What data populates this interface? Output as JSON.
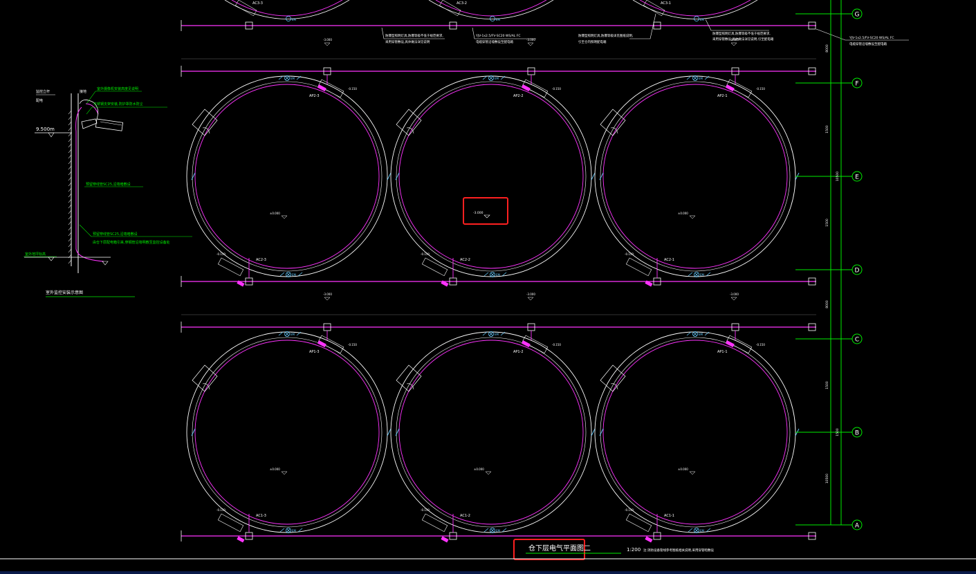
{
  "colors": {
    "background": "#000000",
    "wall": "#ffffff",
    "cable": "#ff33ff",
    "grid_line": "#00ee00",
    "device": "#66ccff",
    "highlight_box": "#ff2020"
  },
  "drawing": {
    "title": "仓下层电气平面图二",
    "scale": "1:200",
    "note": "注:消防设备管线参考图纸相关说明,采用穿管暗敷设",
    "highlight_elevation": "-3.000"
  },
  "grid_axes": [
    "G",
    "F",
    "E",
    "D",
    "C",
    "B",
    "A"
  ],
  "dims": [
    "8000",
    "1500",
    "10500",
    "1500",
    "8000",
    "1500",
    "10500",
    "1500"
  ],
  "silos": {
    "upper_row": [
      "AP2-3",
      "AP2-2",
      "AP2-1"
    ],
    "upper_row_bottom": [
      "AC2-3",
      "AC2-2",
      "AC2-1"
    ],
    "lower_row": [
      "AP1-3",
      "AP1-2",
      "AP1-1"
    ],
    "lower_row_bottom": [
      "AC1-3",
      "AC1-2",
      "AC1-1"
    ],
    "top_cut": [
      "AC3-3",
      "AC3-2",
      "AC3-1"
    ]
  },
  "labels": {
    "em": "EM",
    "center_elev": "±0.000",
    "side_elev": "-0.150",
    "row_elev": "-3.000"
  },
  "top_notes": {
    "n1_line1": "防爆型照明灯具,防爆等级不低于规范要求,",
    "n1_line2": "采用穿管敷设,具体做法详见说明",
    "n2_line1": "YJV-1x2.5/FV-SC20 WS/AL FC",
    "n2_line2": "电缆穿管沿墙敷设至配电箱",
    "n3_line1": "防爆型照明灯具,防爆等级详见图纸说明,",
    "n3_line2": "引至仓内照明配电箱",
    "n4_line1": "防爆型照明灯具,防爆等级不低于规范要求,",
    "n4_line2": "采用穿管敷设,具体做法详见说明,引至配电箱",
    "n5_line1": "YJV-1x2.5/FV-SC20 WS/AL FC",
    "n5_line2": "电缆穿管沿墙敷设至配电箱"
  },
  "detail": {
    "title": "室外监控安装示意图",
    "elev": "9.500m",
    "label_top_left1": "监控立杆",
    "label_top_left2": "配电",
    "label_top_right": "接地",
    "note1": "室外摄像机安装高度见说明",
    "note2": "不锈钢支架安装,防护罩防水防尘",
    "note3": "预留穿线管SC25,沿墙暗敷设",
    "note4": "预留穿线管SC25,沿墙暗敷设",
    "note5": "由仓下层配电箱引来,穿钢管沿墙明敷至监控设备处",
    "ground": "室外地坪标高"
  }
}
